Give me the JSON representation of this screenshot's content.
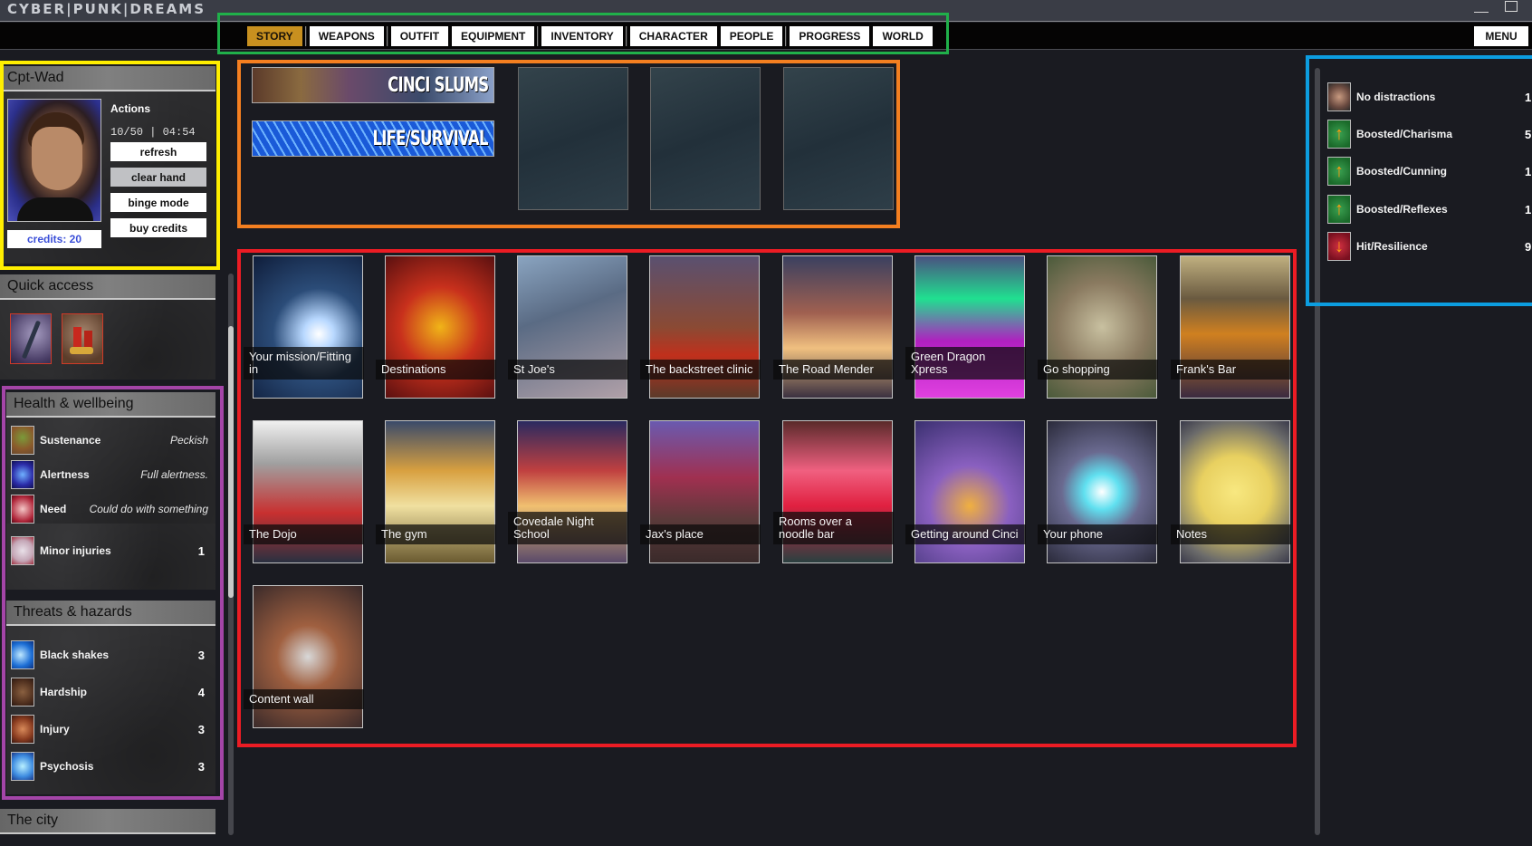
{
  "app": {
    "title": "CYBER|PUNK|DREAMS",
    "window_controls": {
      "minimize": "minimize",
      "maximize": "maximize"
    }
  },
  "nav": {
    "tabs": [
      {
        "label": "STORY",
        "active": true
      },
      {
        "label": "WEAPONS",
        "active": false
      },
      {
        "label": "OUTFIT",
        "active": false
      },
      {
        "label": "EQUIPMENT",
        "active": false
      },
      {
        "label": "INVENTORY",
        "active": false
      },
      {
        "label": "CHARACTER",
        "active": false
      },
      {
        "label": "PEOPLE",
        "active": false
      },
      {
        "label": "PROGRESS",
        "active": false
      },
      {
        "label": "WORLD",
        "active": false
      }
    ],
    "menu_label": "MENU",
    "active_color": "#c8901f"
  },
  "character": {
    "name": "Cpt-Wad",
    "credits": "credits: 20",
    "actions_label": "Actions",
    "actions_value": "10/50 | 04:54",
    "buttons": {
      "refresh": "refresh",
      "clear_hand": "clear hand",
      "binge_mode": "binge mode",
      "buy_credits": "buy credits"
    }
  },
  "quick_access": {
    "title": "Quick access",
    "items": [
      {
        "icon": "shotgun-icon"
      },
      {
        "icon": "shotgun-shells-icon"
      }
    ]
  },
  "health": {
    "title": "Health & wellbeing",
    "items": [
      {
        "name": "Sustenance",
        "value": "Peckish",
        "icon": "food-bag-icon"
      },
      {
        "name": "Alertness",
        "value": "Full alertness.",
        "icon": "alertness-icon"
      },
      {
        "name": "Need",
        "value": "Could do with something",
        "icon": "heart-icon"
      },
      {
        "name": "Minor injuries",
        "value": "1",
        "icon": "blood-splatter-icon"
      }
    ]
  },
  "threats": {
    "title": "Threats & hazards",
    "items": [
      {
        "name": "Black shakes",
        "value": "3",
        "icon": "lightning-icon"
      },
      {
        "name": "Hardship",
        "value": "4",
        "icon": "hardship-icon"
      },
      {
        "name": "Injury",
        "value": "3",
        "icon": "fist-icon"
      },
      {
        "name": "Psychosis",
        "value": "3",
        "icon": "psychosis-icon"
      }
    ]
  },
  "city": {
    "title": "The city"
  },
  "story": {
    "banners": [
      {
        "label": "CINCI SLUMS"
      },
      {
        "label": "LIFE/SURVIVAL"
      }
    ],
    "empty_slots": 3
  },
  "locations": [
    {
      "label": "Your mission/Fitting in"
    },
    {
      "label": "Destinations"
    },
    {
      "label": "St Joe's"
    },
    {
      "label": "The backstreet clinic"
    },
    {
      "label": "The Road Mender"
    },
    {
      "label": "Green Dragon Xpress"
    },
    {
      "label": "Go shopping"
    },
    {
      "label": "Frank's Bar"
    },
    {
      "label": "The Dojo"
    },
    {
      "label": "The gym"
    },
    {
      "label": "Covedale Night School"
    },
    {
      "label": "Jax's place"
    },
    {
      "label": "Rooms over a noodle bar"
    },
    {
      "label": "Getting around Cinci"
    },
    {
      "label": "Your phone"
    },
    {
      "label": "Notes"
    },
    {
      "label": "Content wall"
    }
  ],
  "effects": [
    {
      "name": "No distractions",
      "value": "1",
      "icon": "hand-icon"
    },
    {
      "name": "Boosted/Charisma",
      "value": "5",
      "icon": "arrow-up-icon"
    },
    {
      "name": "Boosted/Cunning",
      "value": "1",
      "icon": "arrow-up-icon"
    },
    {
      "name": "Boosted/Reflexes",
      "value": "1",
      "icon": "arrow-up-icon"
    },
    {
      "name": "Hit/Resilience",
      "value": "9",
      "icon": "arrow-down-icon"
    }
  ],
  "annotation_colors": {
    "nav": "#20b04a",
    "character": "#ffee00",
    "story": "#f47f20",
    "locations": "#ec1c24",
    "effects": "#0c9de0",
    "health": "#a445a8"
  }
}
